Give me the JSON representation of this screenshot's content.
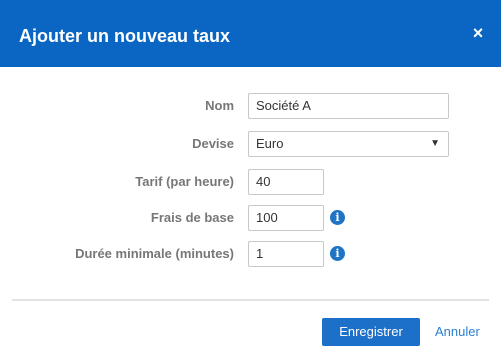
{
  "dialog": {
    "title": "Ajouter un nouveau taux",
    "close_label": "×"
  },
  "form": {
    "name": {
      "label": "Nom",
      "value": "Société A"
    },
    "currency": {
      "label": "Devise",
      "value": "Euro",
      "arrow": "▼"
    },
    "rate": {
      "label": "Tarif (par heure)",
      "value": "40"
    },
    "base_fee": {
      "label": "Frais de base",
      "value": "100",
      "info_icon": "i"
    },
    "min_duration": {
      "label": "Durée minimale (minutes)",
      "value": "1",
      "info_icon": "i"
    }
  },
  "footer": {
    "save_label": "Enregistrer",
    "cancel_label": "Annuler"
  },
  "colors": {
    "header_bg": "#0a65c3",
    "primary_button": "#1c70c8",
    "link": "#2a7fd1",
    "info_icon": "#1f75c4",
    "label_text": "#777777"
  },
  "icons": {
    "close": "close-icon",
    "info": "info-icon",
    "dropdown": "chevron-down-icon"
  }
}
